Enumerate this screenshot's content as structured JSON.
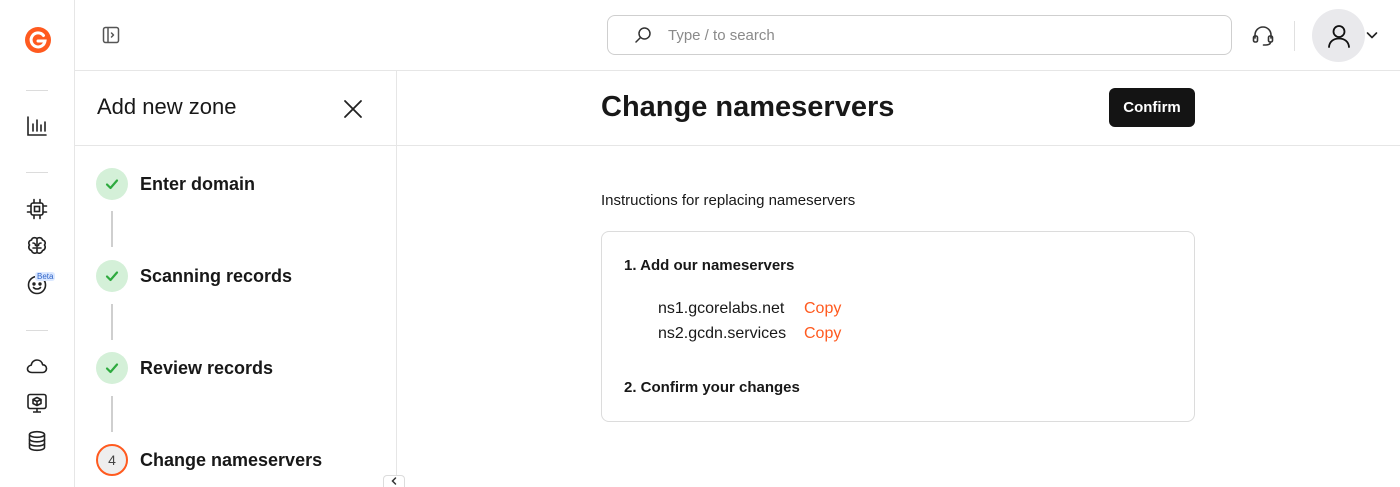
{
  "header": {
    "search_placeholder": "Type / to search"
  },
  "rail": {
    "logo_icon": "gcore-logo-icon",
    "items": [
      {
        "icon": "bar-chart-icon"
      },
      {
        "icon": "chip-icon"
      },
      {
        "icon": "brain-icon"
      },
      {
        "icon": "robot-face-icon",
        "badge": "Beta"
      },
      {
        "icon": "cloud-icon"
      },
      {
        "icon": "monitor-box-icon"
      },
      {
        "icon": "database-icon"
      }
    ]
  },
  "wizard": {
    "title": "Add new zone",
    "steps": [
      {
        "label": "Enter domain",
        "state": "done"
      },
      {
        "label": "Scanning records",
        "state": "done"
      },
      {
        "label": "Review records",
        "state": "done"
      },
      {
        "label": "Change nameservers",
        "state": "current",
        "number": "4"
      }
    ]
  },
  "main": {
    "title": "Change nameservers",
    "confirm_label": "Confirm",
    "instructions": "Instructions for replacing nameservers",
    "card": {
      "step1_heading": "1. Add our nameservers",
      "nameservers": [
        {
          "name": "ns1.gcorelabs.net",
          "copy_label": "Copy"
        },
        {
          "name": "ns2.gcdn.services",
          "copy_label": "Copy"
        }
      ],
      "step2_heading": "2. Confirm your changes"
    }
  },
  "colors": {
    "accent": "#ff5a1f",
    "success_bg": "#d4f0d8",
    "success_check": "#2eaa3f",
    "button_dark": "#141414"
  }
}
